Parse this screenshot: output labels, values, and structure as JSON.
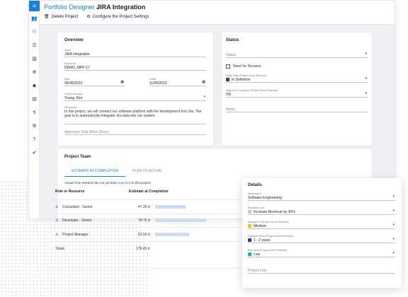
{
  "breadcrumb": {
    "parent": "Portfolio Designer",
    "separator": "›",
    "current": "JIRA Integration"
  },
  "toolbar": {
    "delete_label": "Delete Project",
    "configure_label": "Configure the Project Settings"
  },
  "overview": {
    "title": "Overview",
    "name_label": "Name",
    "name_value": "JIRA Integration",
    "project_no_label": "Project No",
    "project_no_value": "DEMO_MPP-17",
    "start_label": "Start",
    "start_value": "06/06/2023",
    "finish_label": "Finish",
    "finish_value": "11/05/2023",
    "manager_label": "Project Manager",
    "manager_value": "Young, Kim",
    "description_label": "Description",
    "description_value": "In this project, we will connect our software platform with the development tool Jira. The goal is to automatically integrate Jira data into our system.",
    "effort_placeholder": "Approved Total Effort (Days)"
  },
  "status": {
    "title": "Status",
    "status_placeholder": "Status",
    "need_decision_label": "Need for Decision",
    "stage_gate_label": "Stage Gate (Project Score Relevant)",
    "stage_gate_value": "In Definition",
    "completion_label": "Degree of Completion (Project Score Relevant)",
    "completion_value": "0%",
    "notes_placeholder": "Notes",
    "colors": {
      "stage_gate": "#2a3f8f"
    }
  },
  "team": {
    "title": "Project Team",
    "tabs": [
      "ESTIMATE AT COMPLETION",
      "PLAN VS ACTUAL"
    ],
    "note_before": "Actual Time Worked has not yet been ",
    "note_link": "imported",
    "note_after": " to this project.",
    "col_role": "Role or Resource",
    "col_estimate": "Estimate at Completion",
    "rows": [
      {
        "role": "Consultant - Senior",
        "estimate": "47.20 d",
        "fraction": 0.27
      },
      {
        "role": "Developer - Senior",
        "estimate": "78.75 d",
        "fraction": 0.45
      },
      {
        "role": "Project Manager",
        "estimate": "52.50 d",
        "fraction": 0.3
      }
    ],
    "totals_label": "Totals",
    "totals_value": "178.45 d"
  },
  "details": {
    "title": "Details",
    "department_label": "Department",
    "department_value": "Software Engineering",
    "business_goal_label": "Business Goal",
    "business_goal_value": "Increase Revenue by 30%",
    "strategic_fit_label": "Strategic Fit (Project Score Relevant)",
    "strategic_fit_value": "Medium",
    "payback_label": "Payback Period (Project Score Relevant)",
    "payback_value": "1 - 2 years",
    "risk_label": "Risk Level (Project Score Relevant)",
    "risk_value": "Low",
    "project_link_placeholder": "Project Link",
    "colors": {
      "business_goal": "#c8ccd6",
      "strategic_fit": "#f2c318",
      "payback": "#2a3f8f",
      "risk": "#1fb8a8"
    }
  }
}
